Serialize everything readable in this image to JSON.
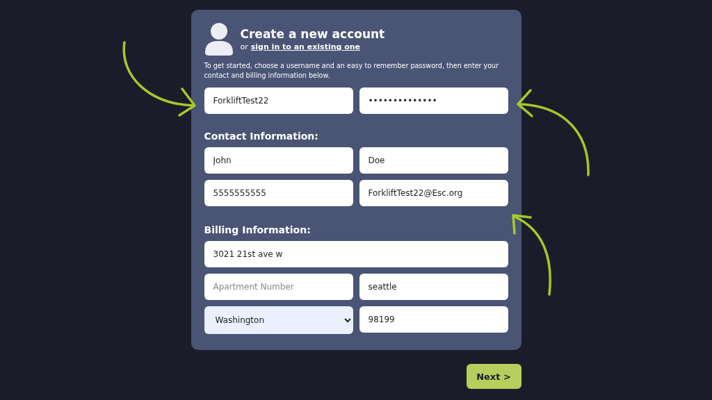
{
  "header": {
    "title": "Create a new account",
    "or_text": "or",
    "sign_in_link": "sign in to an existing one"
  },
  "intro": "To get started, choose a username and an easy to remember password, then enter your contact and billing information below.",
  "account_fields": [
    {
      "kind": "text",
      "value": "ForkliftTest22"
    },
    {
      "kind": "text",
      "value": "••••••••••••••"
    }
  ],
  "sections": [
    {
      "heading": "Contact Information:",
      "fields": [
        {
          "kind": "text",
          "value": "John"
        },
        {
          "kind": "text",
          "value": "Doe"
        },
        {
          "kind": "text",
          "value": "5555555555"
        },
        {
          "kind": "text",
          "value": "ForkliftTest22@Esc.org"
        }
      ]
    },
    {
      "heading": "Billing Information:",
      "fields": [
        {
          "kind": "text",
          "value": "3021 21st ave w",
          "wide": true
        },
        {
          "kind": "text",
          "placeholder": "Apartment Number"
        },
        {
          "kind": "text",
          "value": "seattle"
        },
        {
          "kind": "select",
          "value": "Washington"
        },
        {
          "kind": "text",
          "value": "98199"
        }
      ]
    }
  ],
  "next_button": "Next >"
}
